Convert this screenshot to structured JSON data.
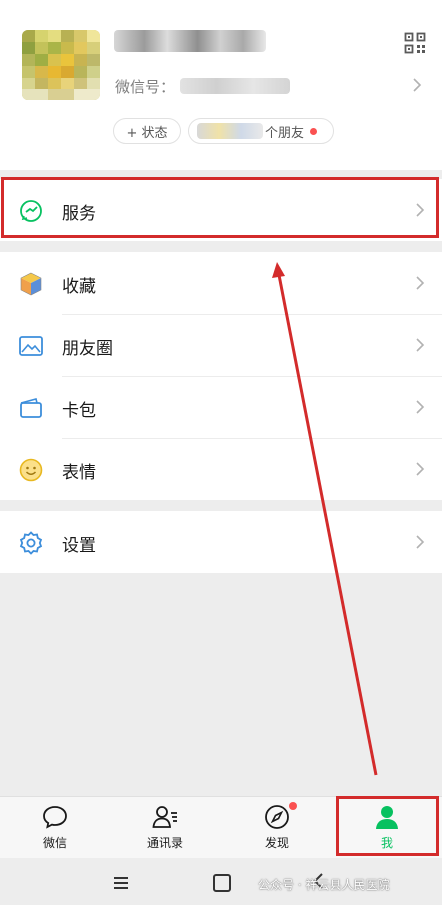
{
  "profile": {
    "wechat_id_label": "微信号：",
    "status_button": "+ 状态",
    "friends_suffix": "个朋友"
  },
  "menu_groups": [
    [
      {
        "id": "services",
        "label": "服务",
        "icon": "services-icon"
      }
    ],
    [
      {
        "id": "favorites",
        "label": "收藏",
        "icon": "favorites-cube-icon"
      },
      {
        "id": "moments",
        "label": "朋友圈",
        "icon": "moments-photo-icon"
      },
      {
        "id": "cards",
        "label": "卡包",
        "icon": "card-wallet-icon"
      },
      {
        "id": "stickers",
        "label": "表情",
        "icon": "smiley-icon"
      }
    ],
    [
      {
        "id": "settings",
        "label": "设置",
        "icon": "gear-icon"
      }
    ]
  ],
  "tabbar": [
    {
      "id": "chats",
      "label": "微信",
      "icon": "chat-bubble-icon",
      "active": false
    },
    {
      "id": "contacts",
      "label": "通讯录",
      "icon": "contacts-icon",
      "active": false
    },
    {
      "id": "discover",
      "label": "发现",
      "icon": "compass-icon",
      "active": false,
      "badge": true
    },
    {
      "id": "me",
      "label": "我",
      "icon": "person-icon",
      "active": true
    }
  ],
  "watermark": "公众号 · 祥云县人民医院",
  "colors": {
    "accent_green": "#07c160",
    "annotation_red": "#d32b2b",
    "badge_red": "#fa5151"
  }
}
